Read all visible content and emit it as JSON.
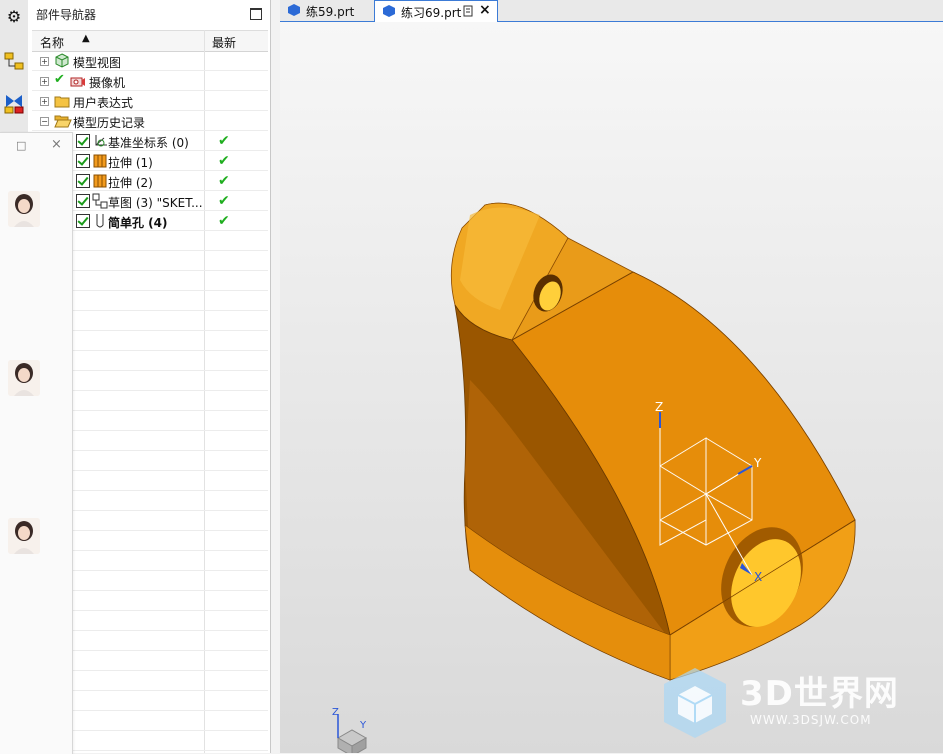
{
  "navigator": {
    "title": "部件导航器",
    "columns": {
      "name": "名称",
      "latest": "最新"
    },
    "rows": [
      {
        "label": "模型视图",
        "icon": "model-views-icon",
        "checked": false,
        "latest": ""
      },
      {
        "label": "摄像机",
        "icon": "camera-icon",
        "checked": false,
        "latest": ""
      },
      {
        "label": "用户表达式",
        "icon": "folder-icon",
        "checked": false,
        "latest": ""
      },
      {
        "label": "模型历史记录",
        "icon": "folder-open-icon",
        "checked": false,
        "latest": ""
      },
      {
        "label": "基准坐标系 (0)",
        "icon": "datum-csys-icon",
        "checked": true,
        "latest": "✔"
      },
      {
        "label": "拉伸 (1)",
        "icon": "extrude-icon",
        "checked": true,
        "latest": "✔"
      },
      {
        "label": "拉伸 (2)",
        "icon": "extrude-icon",
        "checked": true,
        "latest": "✔"
      },
      {
        "label": "草图 (3) \"SKET...",
        "icon": "sketch-icon",
        "checked": true,
        "latest": "✔"
      },
      {
        "label": "简单孔 (4)",
        "icon": "hole-icon",
        "checked": true,
        "latest": "✔"
      }
    ]
  },
  "float_panel": {
    "restore_label": "□",
    "close_label": "×"
  },
  "tabs": [
    {
      "label": "练59.prt",
      "active": false
    },
    {
      "label": "练习69.prt",
      "active": true,
      "close_label": "×"
    }
  ],
  "viewport": {
    "triad_labels": {
      "z": "Z",
      "y": "Y",
      "x": "X"
    },
    "mini_triad_labels": {
      "z": "Z",
      "y": "Y"
    },
    "watermark": {
      "title": "3D世界网",
      "url": "WWW.3DSJW.COM"
    }
  },
  "colors": {
    "part_orange": "#e8900a",
    "accent_blue": "#3c7bd6",
    "check_green": "#1fae1f"
  }
}
